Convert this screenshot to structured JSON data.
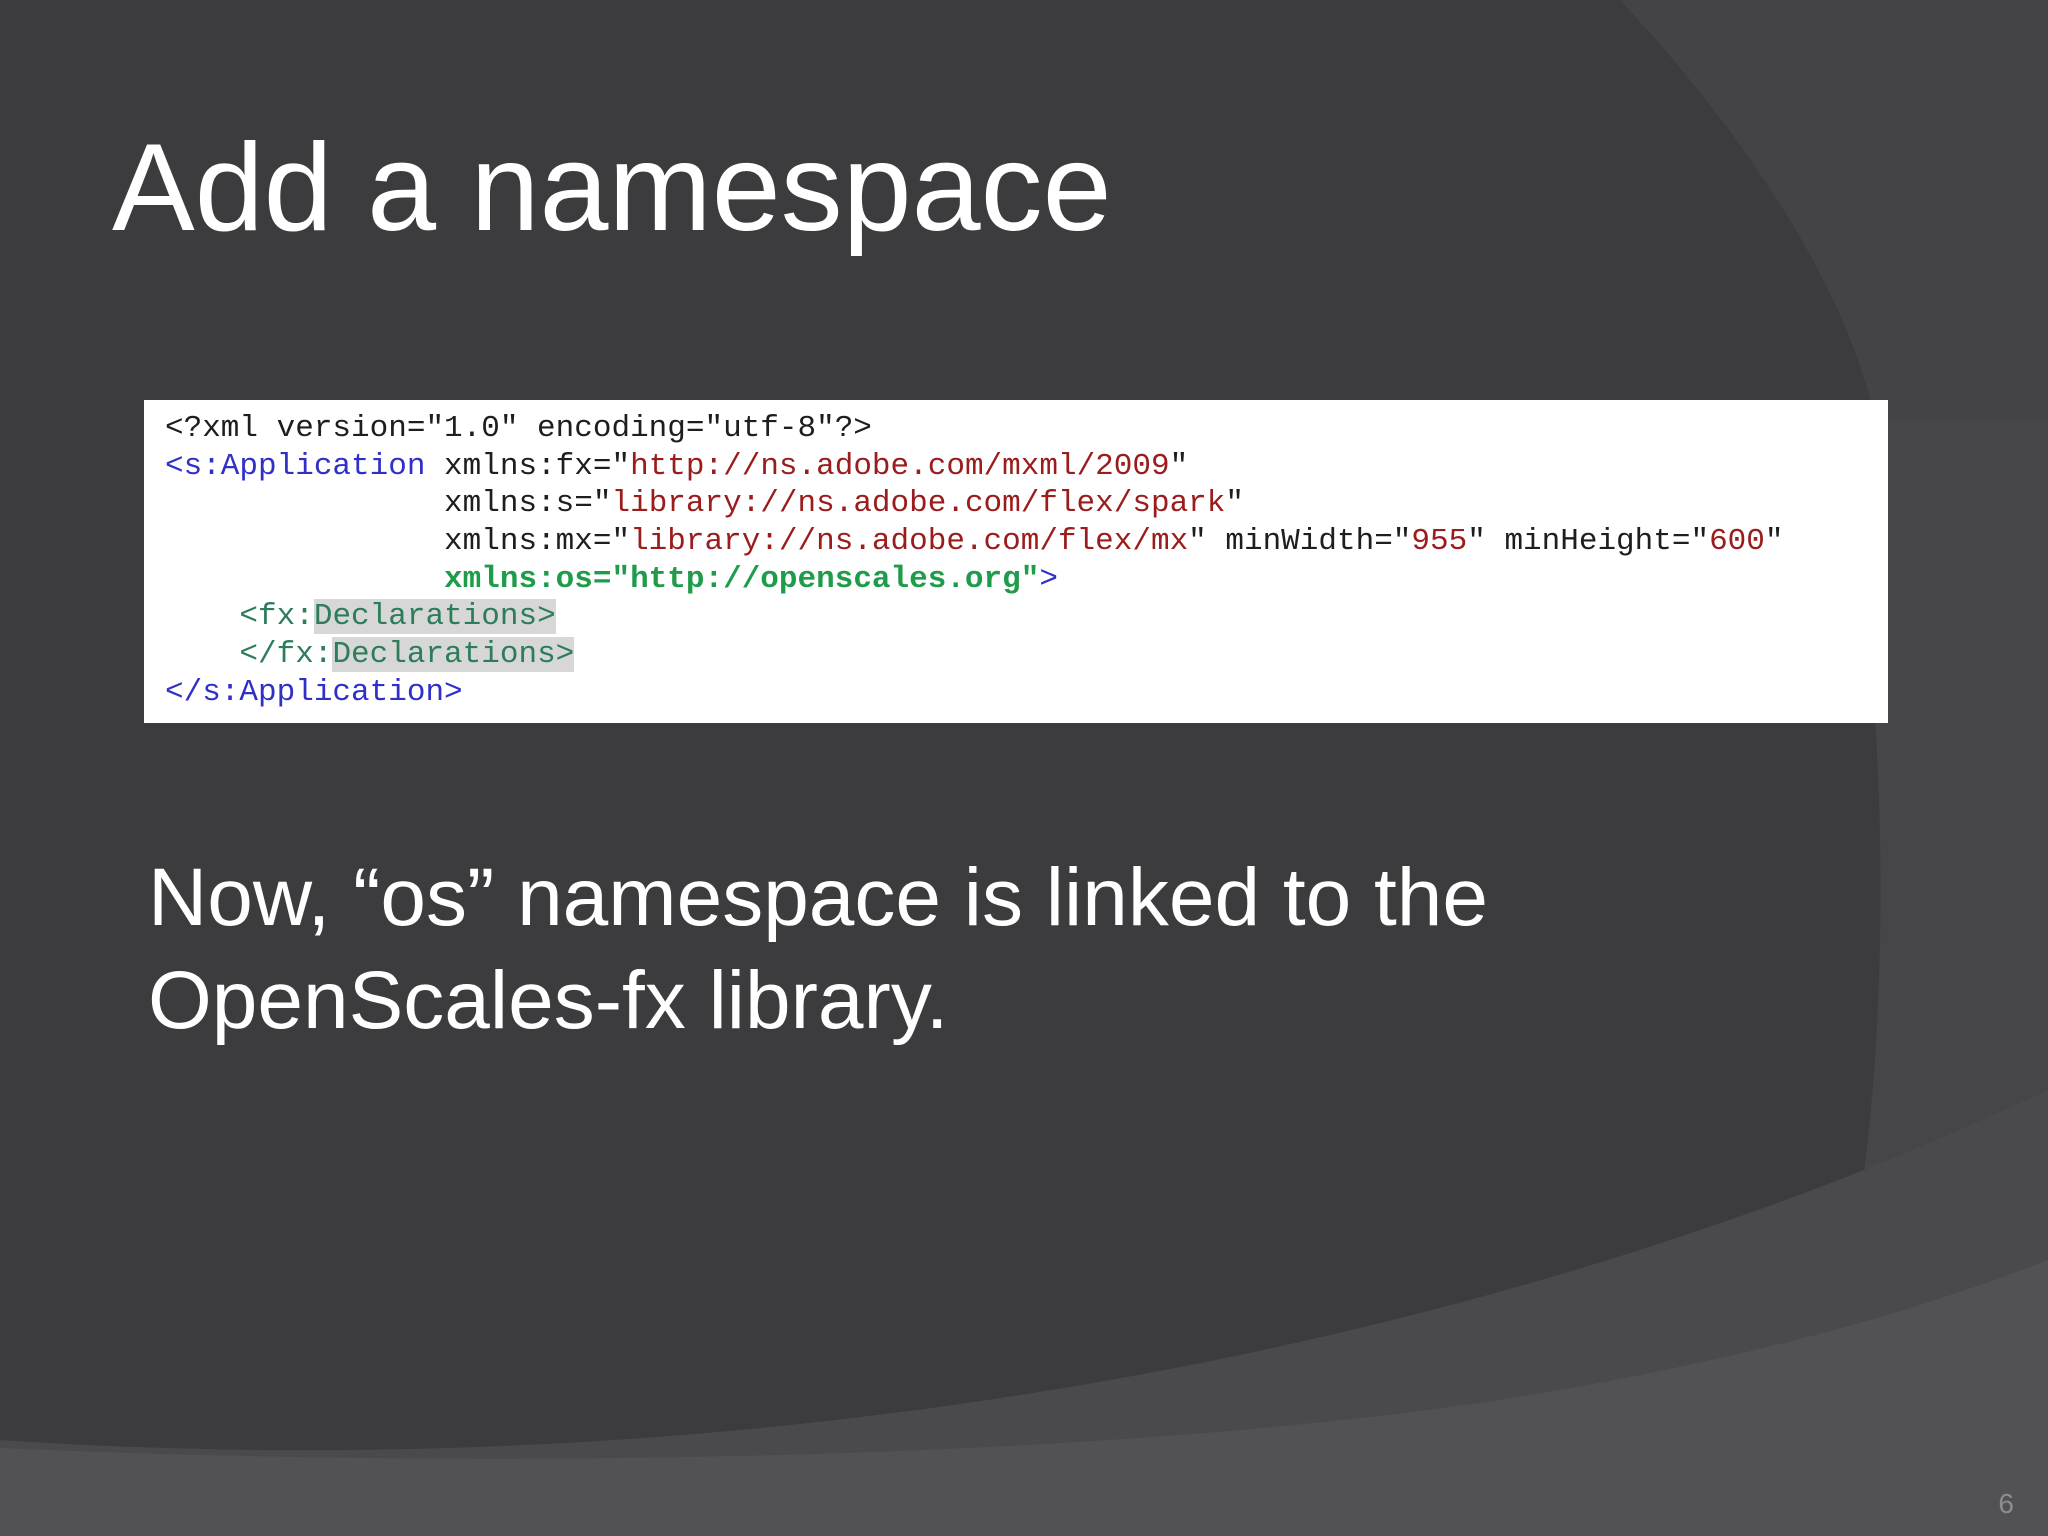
{
  "slide": {
    "title": "Add a namespace",
    "page_number": "6",
    "body_line_1": "Now, “os” namespace is linked to the",
    "body_line_2": "OpenScales-fx library."
  },
  "code": {
    "line1": "<?xml version=\"1.0\" encoding=\"utf-8\"?>",
    "line2": {
      "tag": "<s:Application",
      "attr_prefix": " xmlns:fx=\"",
      "value": "http://ns.adobe.com/mxml/2009",
      "suffix": "\""
    },
    "line3": {
      "indent": "               ",
      "attr_prefix": "xmlns:s=\"",
      "value": "library://ns.adobe.com/flex/spark",
      "suffix": "\""
    },
    "line4": {
      "indent": "               ",
      "attr_prefix": "xmlns:mx=\"",
      "value": "library://ns.adobe.com/flex/mx",
      "mid1": "\" minWidth=\"",
      "value2": "955",
      "mid2": "\" minHeight=\"",
      "value3": "600",
      "suffix": "\""
    },
    "line5": {
      "indent": "               ",
      "bold": "xmlns:os=\"http://openscales.org\"",
      "close": ">"
    },
    "line6": {
      "indent": "    ",
      "prefix": "<fx:",
      "highlight": "Declarations>"
    },
    "line7": {
      "indent": "    ",
      "prefix": "</fx:",
      "highlight": "Declarations>"
    },
    "line8": "</s:Application>"
  },
  "colors": {
    "background": "#3c3b3d",
    "tag": "#3030c8",
    "string": "#9a1c1c",
    "bold_namespace": "#1f9c4a",
    "declarations": "#2e7d5a",
    "highlight": "#d7d7d7"
  }
}
